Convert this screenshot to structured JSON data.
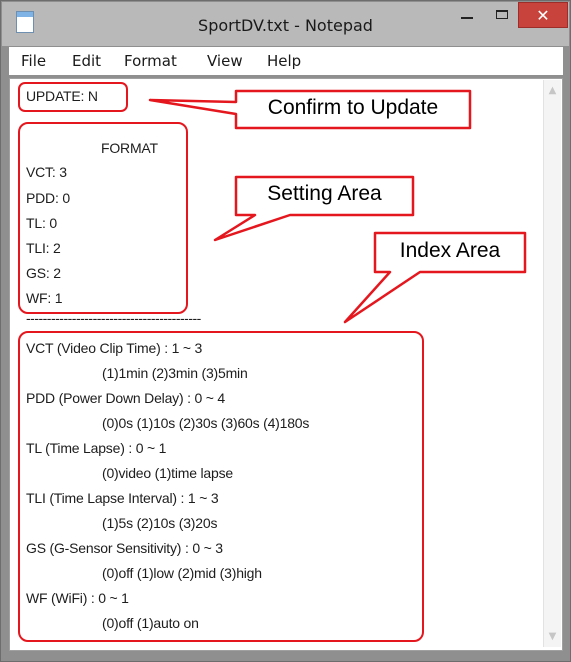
{
  "window": {
    "title": "SportDV.txt - Notepad",
    "close_glyph": "✕"
  },
  "menu": [
    "File",
    "Edit",
    "Format",
    "View",
    "Help"
  ],
  "document": {
    "lines": [
      "UPDATE: N",
      "FORMAT",
      "VCT: 3",
      "PDD: 0",
      "TL: 0",
      "TLI: 2",
      "GS: 2",
      "WF: 1",
      "------------------------------------------",
      "VCT (Video Clip Time) : 1 ~ 3",
      "(1)1min (2)3min (3)5min",
      "PDD (Power Down Delay) : 0 ~ 4",
      "(0)0s (1)10s (2)30s (3)60s (4)180s",
      "TL (Time Lapse) : 0 ~ 1",
      "(0)video (1)time lapse",
      "TLI (Time Lapse Interval) : 1 ~ 3",
      "(1)5s (2)10s (3)20s",
      "GS (G-Sensor Sensitivity) : 0 ~ 3",
      "(0)off (1)low (2)mid (3)high",
      "WF (WiFi) : 0 ~ 1",
      "(0)off (1)auto on"
    ]
  },
  "annotations": {
    "confirm": "Confirm to Update",
    "setting": "Setting Area",
    "index": "Index Area"
  },
  "colors": {
    "annotation": "#e5171e",
    "titlebar": "#b9b9b9",
    "close": "#c7433c"
  },
  "icons": [
    "notepad-icon",
    "minimize-icon",
    "maximize-icon",
    "close-icon",
    "scroll-up-icon",
    "scroll-down-icon"
  ]
}
